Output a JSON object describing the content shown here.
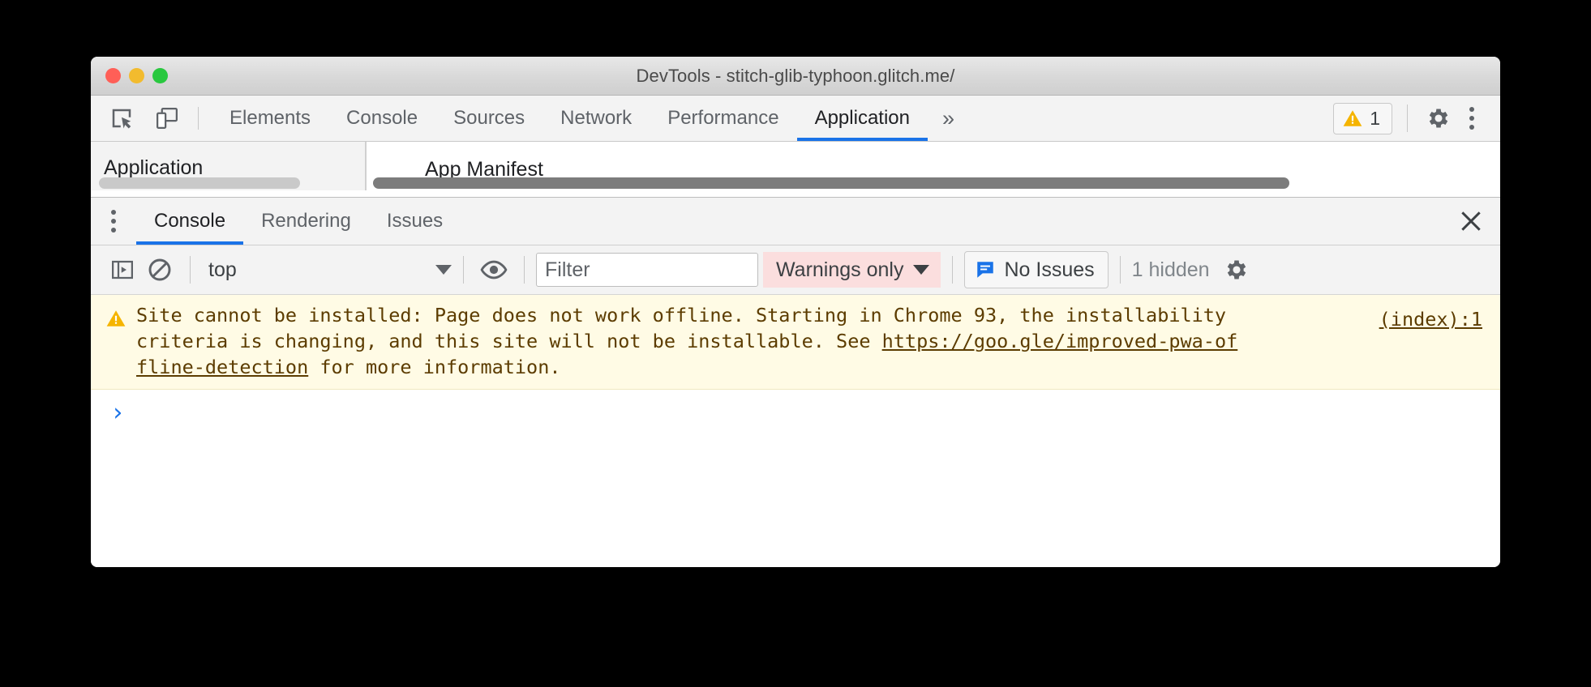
{
  "window": {
    "title": "DevTools - stitch-glib-typhoon.glitch.me/",
    "traffic_lights": {
      "close": "close-window",
      "minimize": "minimize-window",
      "maximize": "maximize-window"
    }
  },
  "main_toolbar": {
    "inspect_icon": "inspect-element-icon",
    "device_icon": "device-toolbar-icon",
    "tabs": [
      {
        "label": "Elements",
        "active": false
      },
      {
        "label": "Console",
        "active": false
      },
      {
        "label": "Sources",
        "active": false
      },
      {
        "label": "Network",
        "active": false
      },
      {
        "label": "Performance",
        "active": false
      },
      {
        "label": "Application",
        "active": true
      }
    ],
    "more_tabs_label": "»",
    "warning_badge": {
      "icon": "warning-triangle-icon",
      "count": "1"
    },
    "settings_icon": "gear-icon",
    "menu_icon": "kebab-menu-icon"
  },
  "clipped_panel": {
    "sidebar_label": "Application",
    "main_label": "App Manifest"
  },
  "drawer": {
    "menu_icon": "kebab-menu-icon",
    "tabs": [
      {
        "label": "Console",
        "active": true
      },
      {
        "label": "Rendering",
        "active": false
      },
      {
        "label": "Issues",
        "active": false
      }
    ],
    "close_icon": "close-icon"
  },
  "console_toolbar": {
    "sidebar_toggle_icon": "console-sidebar-icon",
    "clear_icon": "clear-console-icon",
    "context_selector": {
      "value": "top",
      "caret_icon": "chevron-down-icon"
    },
    "eye_icon": "live-expression-eye-icon",
    "filter": {
      "placeholder": "Filter",
      "value": ""
    },
    "level_selector": {
      "value": "Warnings only",
      "caret_icon": "chevron-down-icon",
      "background": "#fbdede"
    },
    "issues_button": {
      "icon": "issues-message-icon",
      "label": "No Issues"
    },
    "hidden_count": "1 hidden",
    "settings_icon": "gear-icon"
  },
  "console_messages": [
    {
      "level": "warning",
      "icon": "warning-triangle-icon",
      "text_before_link": "Site cannot be installed: Page does not work offline. Starting in Chrome 93, the installability criteria is changing, and this site will not be installable. See ",
      "link_text": "https://goo.gle/improved-pwa-offline-detection",
      "text_after_link": " for more information.",
      "source": "(index):1"
    }
  ],
  "console_prompt": {
    "arrow": "›"
  },
  "colors": {
    "accent_blue": "#1a73e8",
    "warning_row_bg": "#fffbe5",
    "warning_text": "#5c3c00",
    "warning_icon": "#f5b400",
    "level_filter_bg": "#fbdede",
    "window_bg": "#ffffff",
    "toolbar_bg": "#f3f3f3",
    "page_bg": "#000000"
  }
}
